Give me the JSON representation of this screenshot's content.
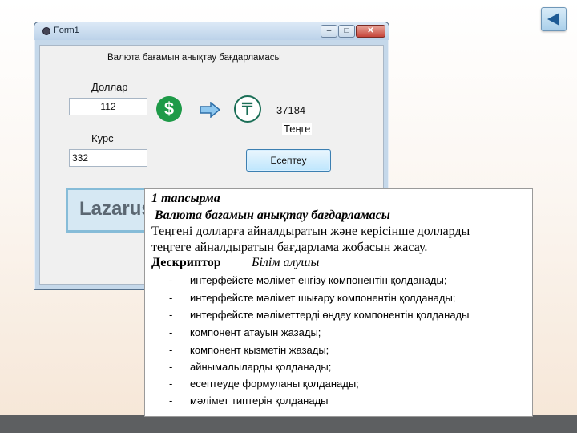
{
  "slide": {
    "nav_back_icon": "triangle-left-icon",
    "accent_color": "#1e5b95"
  },
  "window": {
    "title": "Form1",
    "heading": "Валюта бағамын анықтау бағдарламасы",
    "dollar_label": "Доллар",
    "dollar_value": "112",
    "rate_label": "Курс",
    "rate_value": "332",
    "result_value": "37184",
    "tenge_label": "Теңге",
    "calc_button": "Есептеу",
    "icons": [
      "dollar-icon",
      "arrow-right-icon",
      "tenge-icon"
    ],
    "controls": {
      "minimize": "–",
      "maximize": "□",
      "close": "✕"
    }
  },
  "lazarus_caption": "Lazarus",
  "document": {
    "task_title": "1 тапсырма",
    "task_subtitle": "Валюта бағамын анықтау бағдарламасы",
    "task_text_1": "Теңгені долларға айналдыратын  және керісінше долларды",
    "task_text_2": "теңгеге айналдыратын  бағдарлама жобасын жасау.",
    "descriptor_label": "Дескриптор",
    "descriptor_sub": "Білім алушы",
    "items": [
      "интерфейсте мәлімет енгізу компонентін қолданады;",
      "интерфейсте мәлімет шығару компонентін қолданады;",
      "интерфейсте мәліметтерді өңдеу компонентін қолданады",
      "компонент атауын жазады;",
      "компонент қызметін жазады;",
      " айнымалыларды қолданады;",
      "есептеуде формуланы қолданады;",
      " мәлімет типтерін қолданады"
    ]
  }
}
